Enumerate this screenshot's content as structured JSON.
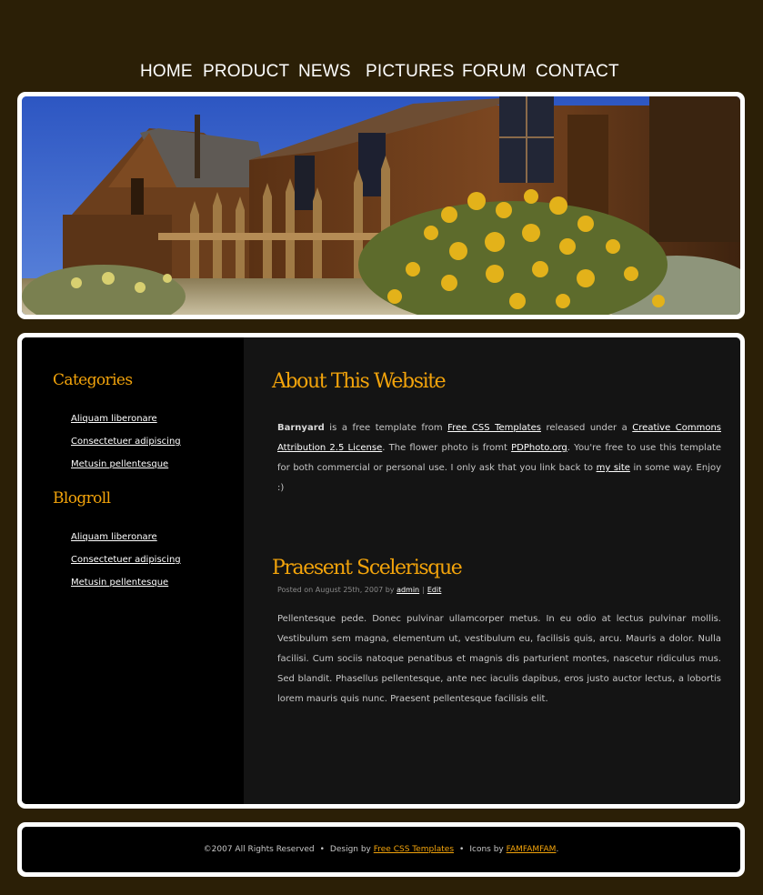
{
  "nav": {
    "items": [
      "HOME",
      "PRODUCT",
      "NEWS",
      "PICTURES",
      "FORUM",
      "CONTACT"
    ]
  },
  "sidebar": {
    "categories": {
      "heading": "Categories",
      "links": [
        "Aliquam liberonare",
        "Consectetuer adipiscing",
        "Metusin pellentesque"
      ]
    },
    "blogroll": {
      "heading": "Blogroll",
      "links": [
        "Aliquam liberonare",
        "Consectetuer adipiscing",
        "Metusin pellentesque"
      ]
    }
  },
  "about": {
    "title": "About This Website",
    "site_name": "Barnyard",
    "text_1": " is a free template from ",
    "link_1": "Free CSS Templates",
    "text_2": " released under a ",
    "link_2": "Creative Commons Attribution 2.5 License",
    "text_3": ". The flower photo is fromt ",
    "link_3": "PDPhoto.org",
    "text_4": ". You're free to use this template for both commercial or personal use. I only ask that you link back to ",
    "link_4": "my site",
    "text_5": " in some way. Enjoy :)"
  },
  "post": {
    "title": "Praesent Scelerisque",
    "meta_prefix": "Posted on August 25th, 2007 by ",
    "meta_author": "admin",
    "meta_separator": "|",
    "meta_edit": "Edit",
    "body": "Pellentesque pede. Donec pulvinar ullamcorper metus. In eu odio at lectus pulvinar mollis. Vestibulum sem magna, elementum ut, vestibulum eu, facilisis quis, arcu. Mauris a dolor. Nulla facilisi. Cum sociis natoque penatibus et magnis dis parturient montes, nascetur ridiculus mus. Sed blandit. Phasellus pellentesque, ante nec iaculis dapibus, eros justo auctor lectus, a lobortis lorem mauris quis nunc. Praesent pellentesque facilisis elit."
  },
  "footer": {
    "copyright": "©2007 All Rights Reserved",
    "dot": "•",
    "design_by": "Design by ",
    "design_link": "Free CSS Templates",
    "icons_by": "Icons by ",
    "icons_link": "FAMFAMFAM",
    "end": "."
  },
  "colors": {
    "background": "#2b1f06",
    "accent": "#f2a30b",
    "frame": "#ffffff",
    "sidebar": "#000000",
    "content": "#141414"
  }
}
